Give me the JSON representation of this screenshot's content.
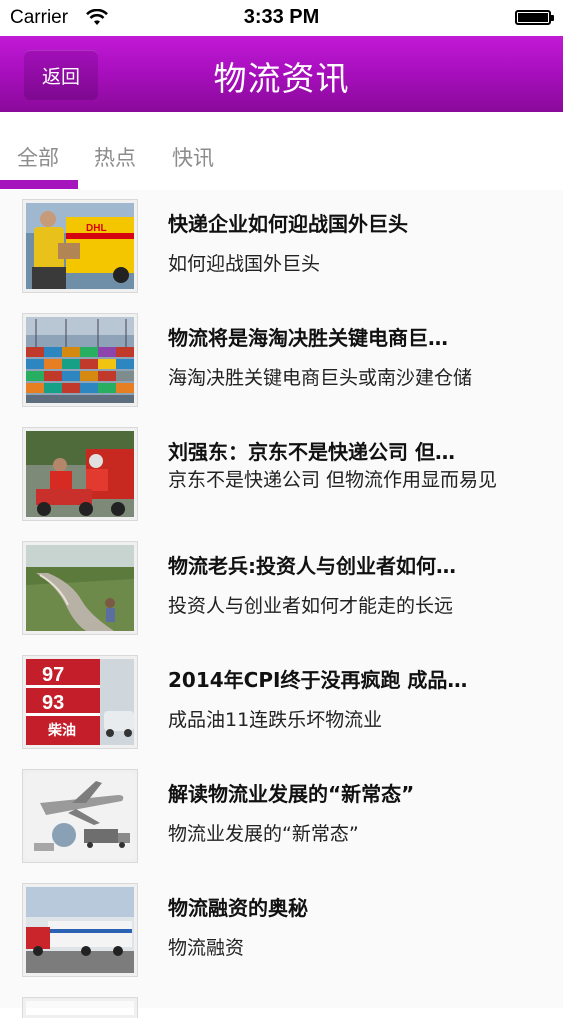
{
  "status_bar": {
    "carrier": "Carrier",
    "time": "3:33 PM"
  },
  "header": {
    "back_label": "返回",
    "title": "物流资讯"
  },
  "tabs": [
    {
      "label": "全部",
      "selected": true
    },
    {
      "label": "热点",
      "selected": false
    },
    {
      "label": "快讯",
      "selected": false
    }
  ],
  "colors": {
    "accent": "#a614bd",
    "header_top": "#c21ad6",
    "header_bottom": "#8a0a9a"
  },
  "articles": [
    {
      "title": "快递企业如何迎战国外巨头",
      "desc": "如何迎战国外巨头",
      "thumb": "dhl-delivery-photo"
    },
    {
      "title": "物流将是海淘决胜关键电商巨…",
      "desc": "海淘决胜关键电商巨头或南沙建仓储",
      "thumb": "container-port-photo"
    },
    {
      "title": "刘强东：京东不是快递公司 但…",
      "desc": "京东不是快递公司 但物流作用显而易见",
      "thumb": "jd-courier-photo"
    },
    {
      "title": "物流老兵:投资人与创业者如何…",
      "desc": "投资人与创业者如何才能走的长远",
      "thumb": "road-walker-photo"
    },
    {
      "title": "2014年CPI终于没再疯跑 成品…",
      "desc": "成品油11连跌乐坏物流业",
      "thumb": "fuel-price-sign-photo",
      "sign": [
        "97",
        "93",
        "柴油"
      ]
    },
    {
      "title": "解读物流业发展的“新常态”",
      "desc": "物流业发展的“新常态”",
      "thumb": "airplane-logistics-illustration"
    },
    {
      "title": "物流融资的奥秘",
      "desc": "物流融资",
      "thumb": "truck-warehouse-photo"
    }
  ]
}
